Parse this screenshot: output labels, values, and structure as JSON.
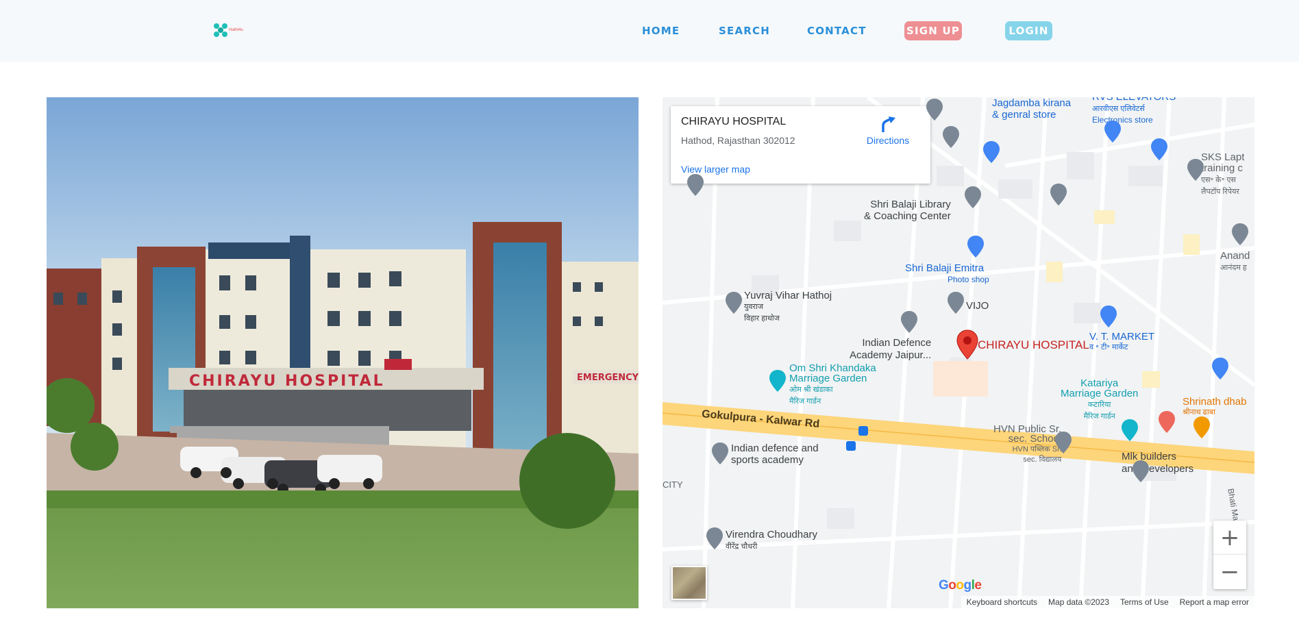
{
  "brand": {
    "logo_text": "Hathi4u",
    "colors": {
      "accent": "#1fbfb8",
      "signup_bg": "#ee8f93",
      "login_bg": "#86d4ea",
      "nav_link": "#2a8fd8"
    }
  },
  "nav": {
    "home": "HOME",
    "search": "SEARCH",
    "contact": "CONTACT",
    "signup": "SIGN UP",
    "login": "LOGIN"
  },
  "photo": {
    "sign_main": "CHIRAYU HOSPITAL",
    "sign_emergency": "EMERGENCY",
    "sign_small": "EMERGENCY"
  },
  "map": {
    "card": {
      "title": "CHIRAYU HOSPITAL",
      "address": "Hathod, Rajasthan 302012",
      "view_larger": "View larger map",
      "directions": "Directions"
    },
    "marker_label": "CHIRAYU HOSPITAL",
    "road_label": "Gokulpura - Kalwar Rd",
    "places": [
      {
        "name": "Jagdamba kirana",
        "sub": "& genral store"
      },
      {
        "name": "RVS ELEVATORS",
        "sub": "आरवीएस एलिवेटर्स",
        "sub2": "Electronics store"
      },
      {
        "name": "SKS Lapt",
        "sub": "training c",
        "sub2": "एस॰ के॰ एस",
        "sub3": "लैपटॉप रिपेयर"
      },
      {
        "name": "Shri Balaji Library",
        "sub": "& Coaching Center"
      },
      {
        "name": "Shri Balaji Emitra",
        "sub": "Photo shop"
      },
      {
        "name": "Anand",
        "sub": "आनंदम ह"
      },
      {
        "name": "Yuvraj Vihar Hathoj",
        "sub": "युवराज",
        "sub2": "विहार हाथोज"
      },
      {
        "name": "VIJO"
      },
      {
        "name": "V. T. MARKET",
        "sub": "व ॰ टी॰ मार्केट"
      },
      {
        "name": "Indian Defence",
        "sub": "Academy Jaipur..."
      },
      {
        "name": "Om Shri Khandaka",
        "sub": "Marriage Garden",
        "sub2": "ओम श्री खंडाका",
        "sub3": "मैरिज गार्डन"
      },
      {
        "name": "Katariya",
        "sub": "Marriage Garden",
        "sub2": "कटारिया",
        "sub3": "मैरिज गार्डन"
      },
      {
        "name": "Shrinath dhab",
        "sub": "श्रीनाथ ढाबा"
      },
      {
        "name": "HVN Public Sr.",
        "sub": "sec. School",
        "sub2": "HVN पब्लिक Sr.",
        "sub3": "sec. विद्यालय"
      },
      {
        "name": "Mlk builders",
        "sub": "and Developers"
      },
      {
        "name": "Indian defence and",
        "sub": "sports academy"
      },
      {
        "name": "Virendra Choudhary",
        "sub": "वीरेंद्र चौधरी"
      },
      {
        "name": "CITY"
      },
      {
        "name": "Bhati Mar"
      }
    ],
    "zoom_in": "+",
    "zoom_out": "−",
    "google": "Google",
    "footer": {
      "shortcuts": "Keyboard shortcuts",
      "data": "Map data ©2023",
      "terms": "Terms of Use",
      "report": "Report a map error"
    }
  }
}
